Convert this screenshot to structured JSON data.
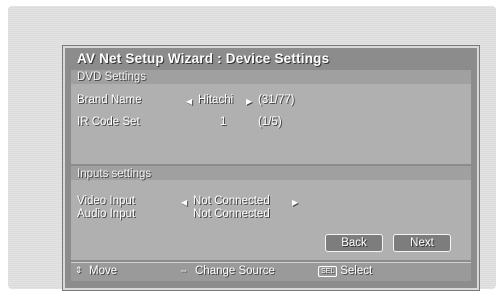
{
  "wizard": {
    "title": "AV Net Setup Wizard : Device Settings"
  },
  "dvd": {
    "header": "DVD Settings",
    "brand_label": "Brand Name",
    "brand_value": "Hitachi",
    "brand_count": "(31/77)",
    "ir_label": "IR Code Set",
    "ir_value": "1",
    "ir_count": "(1/5)"
  },
  "inputs": {
    "header": "Inputs settings",
    "video_label": "Video Input",
    "video_value": "Not Connected",
    "audio_label": "Audio Input",
    "audio_value": "Not Connected"
  },
  "buttons": {
    "back": "Back",
    "next": "Next"
  },
  "footer": {
    "move": "Move",
    "change_source": "Change Source",
    "select_badge": "SEL",
    "select": "Select"
  },
  "icons": {
    "left_arrow": "left-arrow-icon",
    "right_arrow": "right-arrow-icon",
    "updown": "up-down-arrow-icon",
    "leftright": "left-right-arrow-icon"
  }
}
